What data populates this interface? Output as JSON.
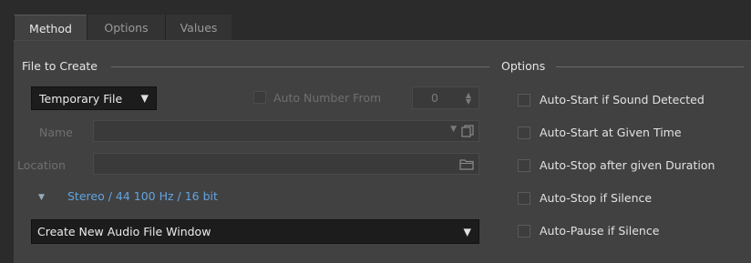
{
  "tabs": [
    {
      "label": "Method"
    },
    {
      "label": "Options"
    },
    {
      "label": "Values"
    }
  ],
  "file_section": {
    "title": "File to Create",
    "file_type": {
      "value": "Temporary File",
      "icon": "triangle-down-icon"
    },
    "auto_number": {
      "label": "Auto Number From",
      "value": "0",
      "checked": false
    },
    "name": {
      "label": "Name",
      "value": ""
    },
    "location": {
      "label": "Location",
      "value": ""
    },
    "format": {
      "label": "Stereo / 44 100 Hz / 16 bit"
    },
    "window_mode": {
      "value": "Create New Audio File Window",
      "icon": "triangle-down-icon"
    }
  },
  "options_section": {
    "title": "Options",
    "items": [
      {
        "label": "Auto-Start if Sound Detected",
        "checked": false
      },
      {
        "label": "Auto-Start at Given Time",
        "checked": false
      },
      {
        "label": "Auto-Stop after given Duration",
        "checked": false
      },
      {
        "label": "Auto-Stop if Silence",
        "checked": false
      },
      {
        "label": "Auto-Pause if Silence",
        "checked": false
      }
    ]
  },
  "colors": {
    "background": "#2b2b2b",
    "panel": "#414141",
    "dropdown": "#1c1c1c",
    "link": "#62a4e0"
  }
}
